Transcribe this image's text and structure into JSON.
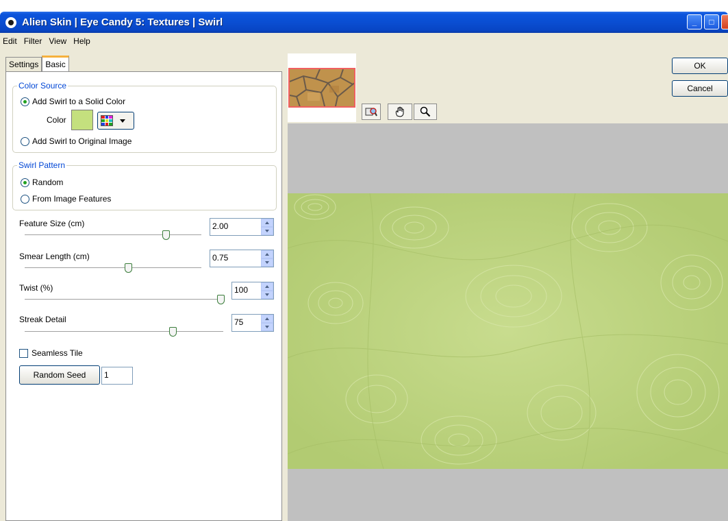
{
  "window": {
    "title": "Alien Skin | Eye Candy 5: Textures | Swirl",
    "minimize": "_",
    "maximize": "□"
  },
  "menu": [
    "Edit",
    "Filter",
    "View",
    "Help"
  ],
  "tabs": [
    {
      "label": "Settings",
      "active": false
    },
    {
      "label": "Basic",
      "active": true
    }
  ],
  "color_source": {
    "title": "Color Source",
    "option_solid": "Add Swirl to a Solid Color",
    "option_solid_selected": true,
    "color_label": "Color",
    "color_value": "#c4e07e",
    "option_original": "Add Swirl to Original Image",
    "option_original_selected": false
  },
  "swirl_pattern": {
    "title": "Swirl Pattern",
    "option_random": "Random",
    "option_random_selected": true,
    "option_features": "From Image Features",
    "option_features_selected": false
  },
  "sliders": {
    "feature_size": {
      "label": "Feature Size (cm)",
      "value": "2.00"
    },
    "smear_length": {
      "label": "Smear Length (cm)",
      "value": "0.75"
    },
    "twist": {
      "label": "Twist (%)",
      "value": "100"
    },
    "streak_detail": {
      "label": "Streak Detail",
      "value": "75"
    }
  },
  "seamless_tile": {
    "label": "Seamless Tile",
    "checked": false
  },
  "random_seed": {
    "button_label": "Random Seed",
    "value": "1"
  },
  "buttons": {
    "ok": "OK",
    "cancel": "Cancel"
  },
  "tools": [
    "navigator-icon",
    "hand-icon",
    "zoom-icon"
  ],
  "colors": {
    "titlebar": "#0a4ed2",
    "panel_bg": "#ece9d8",
    "preview_bg": "#c0c0c0",
    "texture": "#bcd37f",
    "group_title": "#0046d5"
  }
}
